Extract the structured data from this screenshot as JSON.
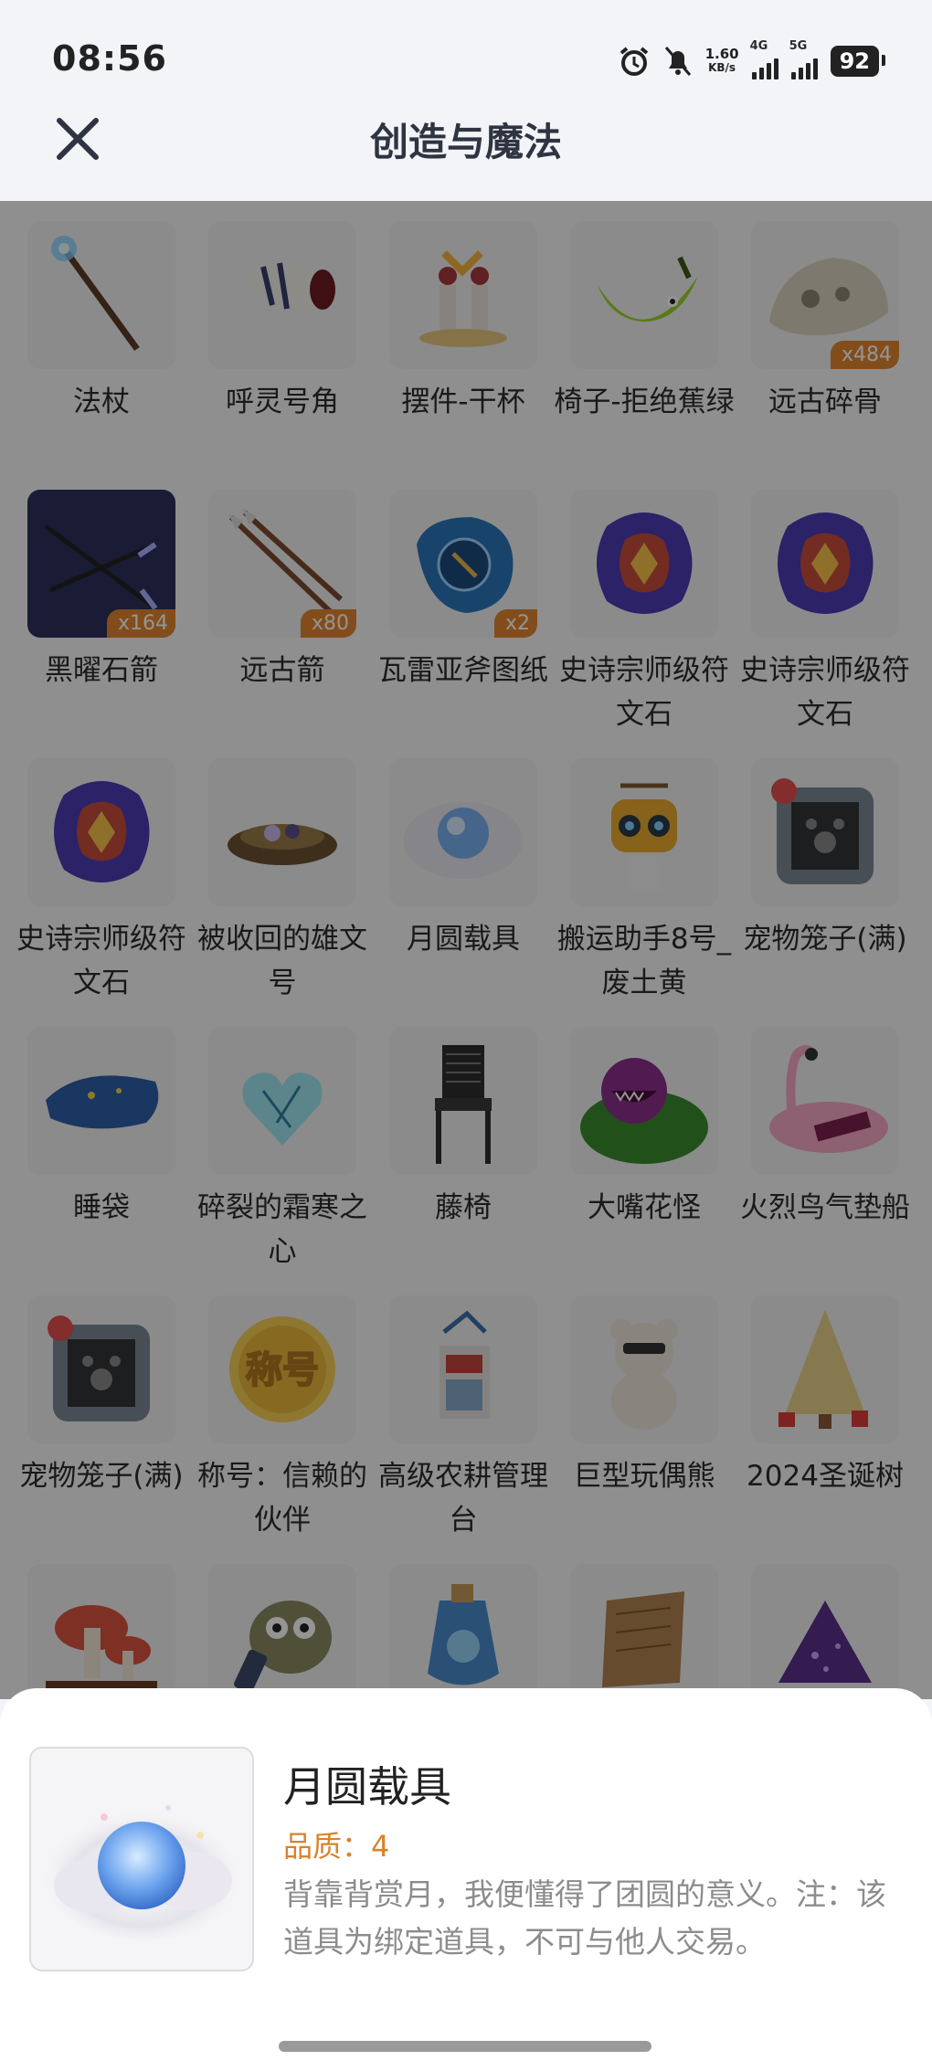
{
  "status_bar": {
    "time": "08:56",
    "net_speed": "1.60",
    "net_unit": "KB/s",
    "sim1": "4G",
    "sim2": "5G",
    "battery": "92"
  },
  "header": {
    "title": "创造与魔法",
    "close_icon": "close-icon"
  },
  "items": [
    {
      "name": "法杖",
      "qty": "",
      "icon": "staff-icon"
    },
    {
      "name": "呼灵号角",
      "qty": "",
      "icon": "horn-icon"
    },
    {
      "name": "摆件-干杯",
      "qty": "",
      "icon": "cheers-figure-icon"
    },
    {
      "name": "椅子-拒绝蕉绿",
      "qty": "",
      "icon": "banana-chair-icon"
    },
    {
      "name": "远古碎骨",
      "qty": "x484",
      "icon": "bone-icon"
    },
    {
      "name": "黑曜石箭",
      "qty": "x164",
      "icon": "obsidian-arrow-icon"
    },
    {
      "name": "远古箭",
      "qty": "x80",
      "icon": "ancient-arrow-icon"
    },
    {
      "name": "瓦雷亚斧图纸",
      "qty": "x2",
      "icon": "axe-blueprint-icon"
    },
    {
      "name": "史诗宗师级符文石",
      "qty": "",
      "icon": "rune-stone-icon"
    },
    {
      "name": "史诗宗师级符文石",
      "qty": "",
      "icon": "rune-stone-icon"
    },
    {
      "name": "史诗宗师级符文石",
      "qty": "",
      "icon": "rune-stone-icon"
    },
    {
      "name": "被收回的雄文号",
      "qty": "",
      "icon": "nest-icon"
    },
    {
      "name": "月圆载具",
      "qty": "",
      "icon": "full-moon-icon"
    },
    {
      "name": "搬运助手8号_废土黄",
      "qty": "",
      "icon": "robot-icon"
    },
    {
      "name": "宠物笼子(满)",
      "qty": "",
      "icon": "pet-cage-icon"
    },
    {
      "name": "睡袋",
      "qty": "",
      "icon": "sleeping-bag-icon"
    },
    {
      "name": "碎裂的霜寒之心",
      "qty": "",
      "icon": "frost-heart-icon"
    },
    {
      "name": "藤椅",
      "qty": "",
      "icon": "rattan-chair-icon"
    },
    {
      "name": "大嘴花怪",
      "qty": "",
      "icon": "piranha-plant-icon"
    },
    {
      "name": "火烈鸟气垫船",
      "qty": "",
      "icon": "flamingo-float-icon"
    },
    {
      "name": "宠物笼子(满)",
      "qty": "",
      "icon": "pet-cage-icon"
    },
    {
      "name": "称号：信赖的伙伴",
      "qty": "",
      "icon": "title-badge-icon"
    },
    {
      "name": "高级农耕管理台",
      "qty": "",
      "icon": "farm-console-icon"
    },
    {
      "name": "巨型玩偶熊",
      "qty": "",
      "icon": "teddy-bear-icon"
    },
    {
      "name": "2024圣诞树",
      "qty": "",
      "icon": "christmas-tree-icon"
    },
    {
      "name": "",
      "qty": "",
      "icon": "mushroom-house-icon"
    },
    {
      "name": "",
      "qty": "",
      "icon": "owl-phone-icon"
    },
    {
      "name": "",
      "qty": "",
      "icon": "bottle-icon"
    },
    {
      "name": "",
      "qty": "",
      "icon": "parchment-icon"
    },
    {
      "name": "",
      "qty": "",
      "icon": "purple-gem-pile-icon"
    }
  ],
  "title_badge_text": "称号",
  "detail": {
    "name": "月圆载具",
    "quality": "品质：4",
    "description": "背靠背赏月，我便懂得了团圆的意义。注：该道具为绑定道具，不可与他人交易。"
  }
}
